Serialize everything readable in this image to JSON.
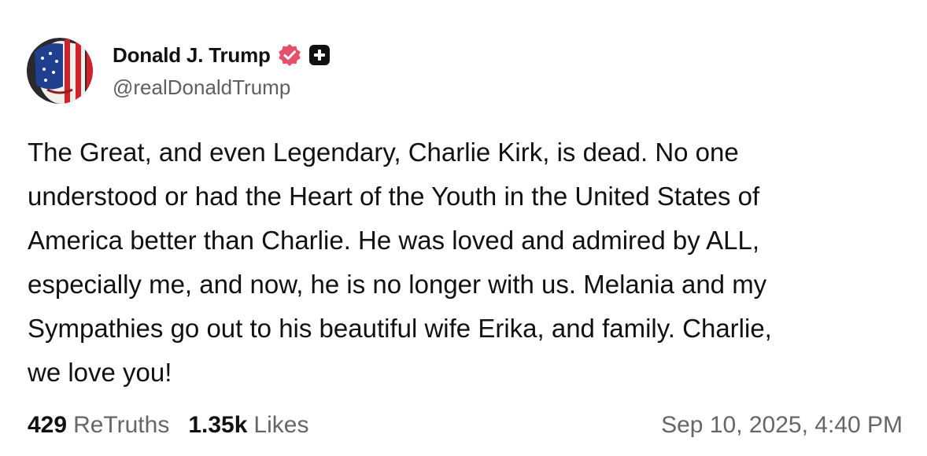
{
  "author": {
    "display_name": "Donald J. Trump",
    "handle": "@realDonaldTrump",
    "verified": true,
    "avatar_icon": "flag-face-avatar",
    "badge_icon": "plus-badge-icon"
  },
  "post": {
    "lines": [
      "The Great, and even Legendary, Charlie Kirk, is dead. No one",
      "understood or had the Heart of the Youth in the United States of",
      "America better than Charlie. He was loved and admired by ALL,",
      "especially me, and now, he is no longer with us. Melania and my",
      "Sympathies go out to his beautiful wife Erika, and family. Charlie,",
      "we love you!"
    ]
  },
  "stats": {
    "retruths_count": "429",
    "retruths_label": "ReTruths",
    "likes_count": "1.35k",
    "likes_label": "Likes"
  },
  "timestamp": "Sep 10, 2025, 4:40 PM",
  "colors": {
    "verified_badge": "#e5506b",
    "plus_badge": "#111111",
    "muted_text": "#666666"
  }
}
